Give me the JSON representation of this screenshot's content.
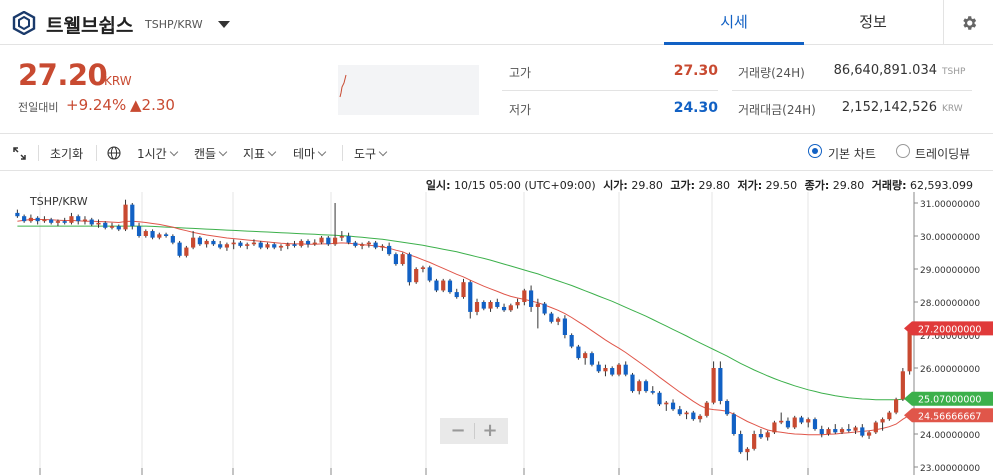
{
  "header": {
    "coin_name": "트웰브쉽스",
    "pair": "TSHP/KRW",
    "tab_price": "시세",
    "tab_info": "정보"
  },
  "price": {
    "current": "27.20",
    "unit": "KRW",
    "change_label": "전일대비",
    "change_pct": "+9.24%",
    "change_abs": "▲2.30"
  },
  "stats": {
    "high_label": "고가",
    "high_value": "27.30",
    "low_label": "저가",
    "low_value": "24.30",
    "volume_label": "거래량(24H)",
    "volume_value": "86,640,891.034",
    "volume_unit": "TSHP",
    "amount_label": "거래대금(24H)",
    "amount_value": "2,152,142,526",
    "amount_unit": "KRW"
  },
  "toolbar": {
    "reset": "초기화",
    "interval": "1시간",
    "candle": "캔들",
    "indicator": "지표",
    "theme": "테마",
    "tools": "도구",
    "basic_chart": "기본 차트",
    "tradingview": "트레이딩뷰"
  },
  "chart_info": {
    "time_label": "일시:",
    "time_value": "10/15 05:00 (UTC+09:00)",
    "open_label": "시가:",
    "open_value": "29.80",
    "high_label": "고가:",
    "high_value": "29.80",
    "low_label": "저가:",
    "low_value": "29.50",
    "close_label": "종가:",
    "close_value": "29.80",
    "vol_label": "거래량:",
    "vol_value": "62,593.099",
    "pair": "TSHP/KRW"
  },
  "colors": {
    "up": "#c84a31",
    "down": "#1261c4",
    "ma_short": "#e0564a",
    "ma_long": "#3cb04b",
    "price_tag": "#e03a3a",
    "ma_long_tag": "#3cb04b",
    "ma_short_tag": "#e0564a"
  },
  "chart_data": {
    "type": "candlestick",
    "y_axis": {
      "min": 23.0,
      "max": 31.0,
      "ticks": [
        "31.00000000",
        "30.00000000",
        "29.00000000",
        "28.00000000",
        "27.00000000",
        "26.00000000",
        "25.00000000",
        "24.00000000",
        "23.00000000"
      ]
    },
    "price_tags": {
      "current": "27.20000000",
      "ma_long": "25.07000000",
      "ma_short": "24.56666667"
    },
    "candles": [
      [
        30.7,
        30.8,
        30.55,
        30.6
      ],
      [
        30.6,
        30.65,
        30.4,
        30.45
      ],
      [
        30.45,
        30.65,
        30.4,
        30.55
      ],
      [
        30.55,
        30.6,
        30.35,
        30.45
      ],
      [
        30.45,
        30.6,
        30.4,
        30.5
      ],
      [
        30.5,
        30.55,
        30.35,
        30.4
      ],
      [
        30.4,
        30.5,
        30.3,
        30.45
      ],
      [
        30.45,
        30.55,
        30.35,
        30.4
      ],
      [
        30.4,
        30.7,
        30.35,
        30.6
      ],
      [
        30.6,
        30.65,
        30.35,
        30.45
      ],
      [
        30.45,
        30.6,
        30.35,
        30.5
      ],
      [
        30.5,
        30.55,
        30.3,
        30.35
      ],
      [
        30.35,
        30.5,
        30.25,
        30.4
      ],
      [
        30.4,
        30.45,
        30.2,
        30.25
      ],
      [
        30.25,
        30.4,
        30.2,
        30.3
      ],
      [
        30.3,
        30.35,
        30.15,
        30.2
      ],
      [
        30.2,
        31.1,
        30.15,
        30.95
      ],
      [
        30.95,
        31.0,
        30.2,
        30.3
      ],
      [
        30.3,
        30.4,
        29.95,
        30.0
      ],
      [
        30.0,
        30.2,
        29.95,
        30.15
      ],
      [
        30.15,
        30.2,
        29.9,
        29.95
      ],
      [
        29.95,
        30.1,
        29.9,
        30.05
      ],
      [
        30.05,
        30.1,
        29.95,
        30.0
      ],
      [
        30.0,
        30.05,
        29.75,
        29.8
      ],
      [
        29.8,
        29.85,
        29.35,
        29.4
      ],
      [
        29.4,
        29.7,
        29.35,
        29.65
      ],
      [
        29.65,
        30.15,
        29.6,
        29.95
      ],
      [
        29.95,
        30.0,
        29.7,
        29.75
      ],
      [
        29.75,
        29.9,
        29.65,
        29.85
      ],
      [
        29.85,
        29.9,
        29.7,
        29.75
      ],
      [
        29.75,
        29.85,
        29.6,
        29.65
      ],
      [
        29.65,
        29.8,
        29.55,
        29.75
      ],
      [
        29.75,
        29.9,
        29.6,
        29.8
      ],
      [
        29.8,
        29.85,
        29.65,
        29.7
      ],
      [
        29.7,
        29.8,
        29.6,
        29.75
      ],
      [
        29.75,
        29.9,
        29.7,
        29.8
      ],
      [
        29.8,
        29.85,
        29.6,
        29.65
      ],
      [
        29.65,
        29.8,
        29.6,
        29.75
      ],
      [
        29.75,
        29.8,
        29.6,
        29.65
      ],
      [
        29.65,
        29.75,
        29.55,
        29.7
      ],
      [
        29.7,
        29.8,
        29.6,
        29.75
      ],
      [
        29.75,
        29.85,
        29.65,
        29.7
      ],
      [
        29.7,
        29.9,
        29.65,
        29.85
      ],
      [
        29.85,
        29.9,
        29.65,
        29.75
      ],
      [
        29.75,
        29.9,
        29.7,
        29.8
      ],
      [
        29.8,
        30.0,
        29.75,
        29.95
      ],
      [
        29.95,
        30.0,
        29.7,
        29.75
      ],
      [
        29.75,
        31.0,
        29.7,
        29.95
      ],
      [
        29.95,
        30.15,
        29.85,
        30.0
      ],
      [
        30.0,
        30.1,
        29.75,
        29.8
      ],
      [
        29.8,
        29.85,
        29.65,
        29.7
      ],
      [
        29.7,
        29.8,
        29.6,
        29.75
      ],
      [
        29.75,
        29.85,
        29.65,
        29.8
      ],
      [
        29.8,
        29.85,
        29.6,
        29.65
      ],
      [
        29.65,
        29.75,
        29.55,
        29.7
      ],
      [
        29.7,
        29.8,
        29.4,
        29.45
      ],
      [
        29.45,
        29.5,
        29.1,
        29.15
      ],
      [
        29.15,
        29.5,
        29.1,
        29.45
      ],
      [
        29.45,
        29.5,
        28.5,
        28.6
      ],
      [
        28.6,
        29.05,
        28.55,
        29.0
      ],
      [
        29.0,
        29.1,
        28.9,
        29.05
      ],
      [
        29.05,
        29.1,
        28.6,
        28.65
      ],
      [
        28.65,
        28.7,
        28.3,
        28.35
      ],
      [
        28.35,
        28.7,
        28.3,
        28.65
      ],
      [
        28.65,
        28.7,
        28.25,
        28.3
      ],
      [
        28.3,
        28.4,
        28.1,
        28.15
      ],
      [
        28.15,
        28.7,
        28.1,
        28.6
      ],
      [
        28.6,
        28.65,
        27.5,
        27.7
      ],
      [
        27.7,
        28.1,
        27.6,
        28.0
      ],
      [
        28.0,
        28.05,
        27.75,
        27.8
      ],
      [
        27.8,
        28.05,
        27.7,
        28.0
      ],
      [
        28.0,
        28.1,
        27.8,
        27.85
      ],
      [
        27.85,
        27.95,
        27.7,
        27.75
      ],
      [
        27.75,
        27.95,
        27.7,
        27.9
      ],
      [
        27.9,
        28.1,
        27.8,
        28.0
      ],
      [
        28.0,
        28.4,
        27.9,
        28.35
      ],
      [
        28.35,
        28.5,
        27.7,
        27.85
      ],
      [
        27.85,
        28.1,
        27.2,
        27.95
      ],
      [
        27.95,
        28.0,
        27.6,
        27.65
      ],
      [
        27.65,
        27.7,
        27.35,
        27.4
      ],
      [
        27.4,
        27.55,
        27.3,
        27.5
      ],
      [
        27.5,
        27.6,
        26.9,
        27.0
      ],
      [
        27.0,
        27.05,
        26.6,
        26.65
      ],
      [
        26.65,
        26.7,
        26.25,
        26.3
      ],
      [
        26.3,
        26.5,
        26.1,
        26.45
      ],
      [
        26.45,
        26.5,
        26.05,
        26.1
      ],
      [
        26.1,
        26.2,
        25.85,
        25.9
      ],
      [
        25.9,
        26.1,
        25.75,
        26.0
      ],
      [
        26.0,
        26.05,
        25.75,
        25.8
      ],
      [
        25.8,
        26.15,
        25.75,
        26.1
      ],
      [
        26.1,
        26.2,
        25.75,
        25.8
      ],
      [
        25.8,
        25.85,
        25.25,
        25.3
      ],
      [
        25.3,
        25.65,
        25.2,
        25.6
      ],
      [
        25.6,
        25.65,
        25.25,
        25.3
      ],
      [
        25.3,
        25.45,
        25.2,
        25.25
      ],
      [
        25.25,
        25.3,
        24.85,
        24.9
      ],
      [
        24.9,
        25.0,
        24.7,
        24.95
      ],
      [
        24.95,
        25.05,
        24.7,
        24.75
      ],
      [
        24.75,
        24.85,
        24.55,
        24.6
      ],
      [
        24.6,
        24.7,
        24.45,
        24.65
      ],
      [
        24.65,
        24.7,
        24.4,
        24.45
      ],
      [
        24.45,
        24.6,
        24.35,
        24.55
      ],
      [
        24.55,
        25.0,
        24.5,
        24.95
      ],
      [
        24.95,
        26.2,
        24.9,
        26.0
      ],
      [
        26.0,
        26.2,
        24.9,
        25.0
      ],
      [
        25.0,
        25.05,
        24.55,
        24.6
      ],
      [
        24.6,
        24.65,
        23.95,
        24.0
      ],
      [
        24.0,
        24.1,
        23.4,
        23.45
      ],
      [
        23.45,
        23.6,
        23.2,
        23.55
      ],
      [
        23.55,
        24.1,
        23.5,
        24.0
      ],
      [
        24.0,
        24.15,
        23.85,
        23.9
      ],
      [
        23.9,
        24.1,
        23.8,
        24.05
      ],
      [
        24.05,
        24.4,
        24.0,
        24.35
      ],
      [
        24.35,
        24.65,
        24.3,
        24.4
      ],
      [
        24.4,
        24.5,
        24.15,
        24.2
      ],
      [
        24.2,
        24.55,
        24.15,
        24.5
      ],
      [
        24.5,
        24.55,
        24.3,
        24.35
      ],
      [
        24.35,
        24.5,
        24.2,
        24.45
      ],
      [
        24.45,
        24.5,
        24.1,
        24.15
      ],
      [
        24.15,
        24.25,
        23.9,
        24.0
      ],
      [
        24.0,
        24.2,
        23.95,
        24.15
      ],
      [
        24.15,
        24.3,
        24.0,
        24.05
      ],
      [
        24.05,
        24.2,
        24.0,
        24.15
      ],
      [
        24.15,
        24.3,
        24.05,
        24.1
      ],
      [
        24.1,
        24.25,
        24.0,
        24.2
      ],
      [
        24.2,
        24.3,
        23.9,
        23.95
      ],
      [
        23.95,
        24.1,
        23.85,
        24.05
      ],
      [
        24.05,
        24.4,
        24.0,
        24.35
      ],
      [
        24.35,
        24.5,
        24.1,
        24.45
      ],
      [
        24.45,
        24.7,
        24.4,
        24.65
      ],
      [
        24.65,
        25.1,
        24.6,
        25.05
      ],
      [
        25.05,
        26.0,
        25.0,
        25.9
      ],
      [
        25.9,
        27.3,
        25.8,
        27.2
      ]
    ],
    "ma_short": [
      30.45,
      30.48,
      30.5,
      30.5,
      30.5,
      30.49,
      30.48,
      30.47,
      30.47,
      30.46,
      30.45,
      30.45,
      30.44,
      30.43,
      30.42,
      30.41,
      30.44,
      30.45,
      30.43,
      30.41,
      30.38,
      30.35,
      30.31,
      30.27,
      30.21,
      30.16,
      30.11,
      30.07,
      30.03,
      30.0,
      29.97,
      29.94,
      29.92,
      29.9,
      29.88,
      29.86,
      29.84,
      29.82,
      29.8,
      29.78,
      29.77,
      29.76,
      29.76,
      29.75,
      29.75,
      29.76,
      29.76,
      29.78,
      29.79,
      29.78,
      29.76,
      29.74,
      29.72,
      29.7,
      29.67,
      29.63,
      29.57,
      29.52,
      29.43,
      29.36,
      29.28,
      29.2,
      29.11,
      29.02,
      28.93,
      28.84,
      28.76,
      28.66,
      28.57,
      28.48,
      28.4,
      28.32,
      28.24,
      28.17,
      28.12,
      28.08,
      28.03,
      27.98,
      27.91,
      27.83,
      27.75,
      27.65,
      27.53,
      27.4,
      27.27,
      27.13,
      26.99,
      26.85,
      26.72,
      26.6,
      26.47,
      26.32,
      26.18,
      26.03,
      25.88,
      25.72,
      25.57,
      25.42,
      25.27,
      25.13,
      24.99,
      24.86,
      24.77,
      24.74,
      24.72,
      24.69,
      24.6,
      24.49,
      24.38,
      24.29,
      24.2,
      24.12,
      24.08,
      24.05,
      24.02,
      24.0,
      23.99,
      23.98,
      23.98,
      23.98,
      23.99,
      24.0,
      24.02,
      24.04,
      24.06,
      24.08,
      24.1,
      24.13,
      24.17,
      24.22,
      24.3,
      24.45,
      24.57
    ],
    "ma_long": [
      30.3,
      30.3,
      30.3,
      30.3,
      30.3,
      30.3,
      30.3,
      30.3,
      30.3,
      30.3,
      30.3,
      30.3,
      30.3,
      30.3,
      30.3,
      30.3,
      30.3,
      30.3,
      30.3,
      30.3,
      30.29,
      30.28,
      30.27,
      30.26,
      30.25,
      30.24,
      30.23,
      30.22,
      30.21,
      30.2,
      30.19,
      30.18,
      30.17,
      30.16,
      30.15,
      30.14,
      30.13,
      30.12,
      30.11,
      30.1,
      30.09,
      30.08,
      30.07,
      30.06,
      30.05,
      30.04,
      30.03,
      30.02,
      30.01,
      30.0,
      29.98,
      29.96,
      29.94,
      29.92,
      29.9,
      29.87,
      29.84,
      29.81,
      29.78,
      29.75,
      29.72,
      29.68,
      29.64,
      29.6,
      29.56,
      29.52,
      29.47,
      29.42,
      29.37,
      29.32,
      29.27,
      29.21,
      29.15,
      29.09,
      29.03,
      28.97,
      28.91,
      28.85,
      28.78,
      28.71,
      28.64,
      28.57,
      28.5,
      28.42,
      28.34,
      28.26,
      28.18,
      28.1,
      28.02,
      27.93,
      27.84,
      27.75,
      27.66,
      27.57,
      27.47,
      27.37,
      27.27,
      27.17,
      27.07,
      26.97,
      26.86,
      26.76,
      26.66,
      26.56,
      26.46,
      26.36,
      26.25,
      26.14,
      26.04,
      25.94,
      25.85,
      25.76,
      25.68,
      25.6,
      25.53,
      25.46,
      25.4,
      25.34,
      25.29,
      25.24,
      25.2,
      25.16,
      25.13,
      25.1,
      25.08,
      25.06,
      25.05,
      25.04,
      25.04,
      25.04,
      25.04,
      25.05,
      25.07
    ]
  }
}
